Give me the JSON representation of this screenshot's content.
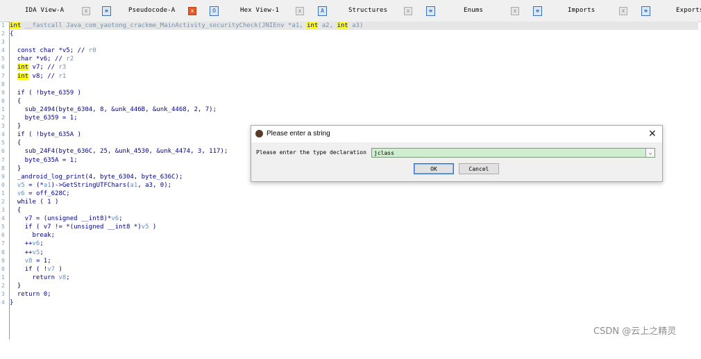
{
  "tabs": [
    {
      "label": "IDA View-A",
      "active": false
    },
    {
      "label": "Pseudocode-A",
      "active": true
    },
    {
      "label": "Hex View-1",
      "active": false
    },
    {
      "label": "Structures",
      "active": false
    },
    {
      "label": "Enums",
      "active": false
    },
    {
      "label": "Imports",
      "active": false
    },
    {
      "label": "Exports",
      "active": false
    }
  ],
  "code": {
    "signature": {
      "ret": "int",
      "part1": " __fastcall Java_com_yaotong_crackme_MainActivity_securityCheck(JNIEnv *a1, ",
      "t2": "int",
      "part2": " a2, ",
      "t3": "int",
      "part3": " a3)"
    },
    "open_brace": "{",
    "decl1": "  const char *v5; // ",
    "decl1_c": "r0",
    "decl2": "  char *v6; // ",
    "decl2_c": "r2",
    "decl3_t": "int",
    "decl3": " v7; // ",
    "decl3_c": "r3",
    "decl4_t": "int",
    "decl4": " v8; // ",
    "decl4_c": "r1",
    "l7": "  if ( !byte_6359 )",
    "l8": "  {",
    "l9": "    sub_2494(byte_6304, 8, &unk_446B, &unk_4468, 2, 7);",
    "l10": "    byte_6359 = 1;",
    "l11": "  }",
    "l12": "  if ( !byte_635A )",
    "l13": "  {",
    "l14": "    sub_24F4(byte_636C, 25, &unk_4530, &unk_4474, 3, 117);",
    "l15": "    byte_635A = 1;",
    "l16": "  }",
    "l17": "  _android_log_print(4, byte_6304, byte_636C);",
    "l18a": "v5",
    "l18b": " = (*",
    "l18c": "a1",
    "l18d": ")->GetStringUTFChars(",
    "l18e": "a1",
    "l18f": ", a3, 0);",
    "l19a": "v6",
    "l19b": " = off_628C;",
    "l20": "  while ( 1 )",
    "l21": "  {",
    "l22a": "    v7 = (unsigned __int8)*",
    "l22b": "v6",
    "l22c": ";",
    "l23a": "    if ( v7 != *(unsigned __int8 *)",
    "l23b": "v5",
    "l23c": " )",
    "l24": "      break;",
    "l25a": "    ++",
    "l25b": "v6",
    "l25c": ";",
    "l26a": "    ++",
    "l26b": "v5",
    "l26c": ";",
    "l27a": "v8",
    "l27b": " = 1;",
    "l28a": "    if ( !",
    "l28b": "v7",
    "l28c": " )",
    "l29a": "      return ",
    "l29b": "v8",
    "l29c": ";",
    "l30": "  }",
    "l31": "  return 0;",
    "close_brace": "}"
  },
  "dialog": {
    "title": "Please enter a string",
    "label": "Please enter the type declaration",
    "value": "jclass",
    "ok": "OK",
    "cancel": "Cancel",
    "close": "✕"
  },
  "watermark": "CSDN @云上之精灵"
}
